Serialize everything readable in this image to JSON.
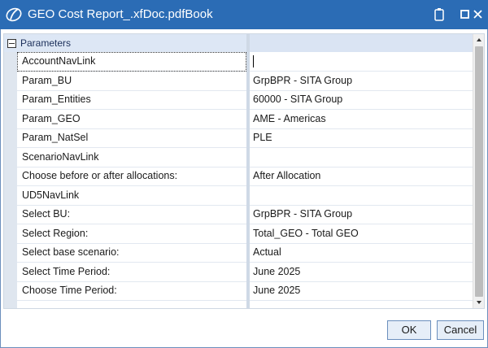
{
  "window": {
    "title": "GEO Cost Report_.xfDoc.pdfBook"
  },
  "grid": {
    "category": "Parameters",
    "rows": [
      {
        "name": "AccountNavLink",
        "value": "",
        "selected": true
      },
      {
        "name": "Param_BU",
        "value": "GrpBPR - SITA Group"
      },
      {
        "name": "Param_Entities",
        "value": "60000 - SITA Group"
      },
      {
        "name": "Param_GEO",
        "value": "AME - Americas"
      },
      {
        "name": "Param_NatSel",
        "value": "PLE"
      },
      {
        "name": "ScenarioNavLink",
        "value": ""
      },
      {
        "name": "Choose before or after allocations:",
        "value": "After Allocation"
      },
      {
        "name": "UD5NavLink",
        "value": ""
      },
      {
        "name": "Select BU:",
        "value": "GrpBPR - SITA Group"
      },
      {
        "name": "Select Region:",
        "value": "Total_GEO - Total GEO"
      },
      {
        "name": "Select base scenario:",
        "value": "Actual"
      },
      {
        "name": "Select Time Period:",
        "value": "June 2025"
      },
      {
        "name": "Choose Time Period:",
        "value": "June 2025"
      }
    ]
  },
  "buttons": {
    "ok": "OK",
    "cancel": "Cancel"
  },
  "colors": {
    "titlebar": "#2b6cb5",
    "header": "#dde7f5",
    "button_border": "#6b8fbd"
  }
}
